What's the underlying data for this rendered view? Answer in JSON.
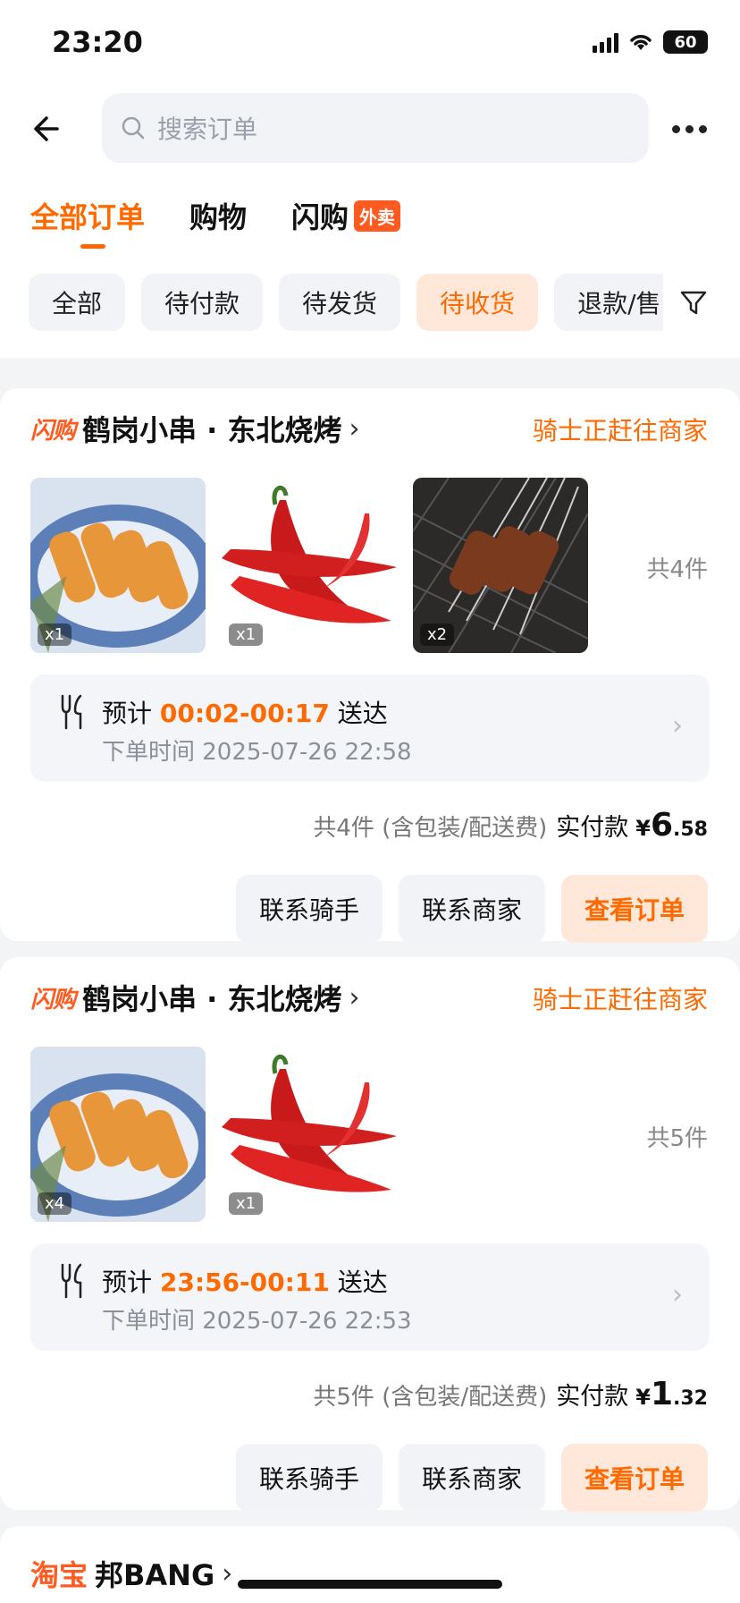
{
  "status_bar": {
    "time": "23:20",
    "battery": "60"
  },
  "search": {
    "placeholder": "搜索订单"
  },
  "tabs": [
    {
      "label": "全部订单",
      "active": true
    },
    {
      "label": "购物",
      "active": false
    },
    {
      "label": "闪购",
      "badge": "外卖",
      "active": false
    }
  ],
  "filters": [
    {
      "label": "全部",
      "active": false
    },
    {
      "label": "待付款",
      "active": false
    },
    {
      "label": "待发货",
      "active": false
    },
    {
      "label": "待收货",
      "active": true
    },
    {
      "label": "退款/售",
      "active": false
    }
  ],
  "orders": [
    {
      "brand": "闪购",
      "shop": "鹤岗小串 · 东北烧烤",
      "status": "骑士正赶往商家",
      "items": [
        {
          "icon": "skewers-image",
          "qty": "x1"
        },
        {
          "icon": "chili-image",
          "qty": "x1"
        },
        {
          "icon": "grilled-meat-image",
          "qty": "x2"
        }
      ],
      "count": "共4件",
      "eta_prefix": "预计",
      "eta_time": "00:02-00:17",
      "eta_suffix": "送达",
      "placed": "下单时间 2025-07-26 22:58",
      "summary": "共4件 (含包装/配送费)",
      "paid_label": "实付款",
      "currency": "¥",
      "amount_int": "6",
      "amount_dec": ".58",
      "actions": [
        "联系骑手",
        "联系商家",
        "查看订单"
      ]
    },
    {
      "brand": "闪购",
      "shop": "鹤岗小串 · 东北烧烤",
      "status": "骑士正赶往商家",
      "items": [
        {
          "icon": "skewers-image",
          "qty": "x4"
        },
        {
          "icon": "chili-image",
          "qty": "x1"
        }
      ],
      "count": "共5件",
      "eta_prefix": "预计",
      "eta_time": "23:56-00:11",
      "eta_suffix": "送达",
      "placed": "下单时间 2025-07-26 22:53",
      "summary": "共5件 (含包装/配送费)",
      "paid_label": "实付款",
      "currency": "¥",
      "amount_int": "1",
      "amount_dec": ".32",
      "actions": [
        "联系骑手",
        "联系商家",
        "查看订单"
      ]
    }
  ],
  "next_card": {
    "brand": "淘宝",
    "title": "邦BANG"
  },
  "colors": {
    "accent": "#ff6a00",
    "chip_active_bg": "#ffe8da",
    "page_bg": "#f3f4f6"
  }
}
